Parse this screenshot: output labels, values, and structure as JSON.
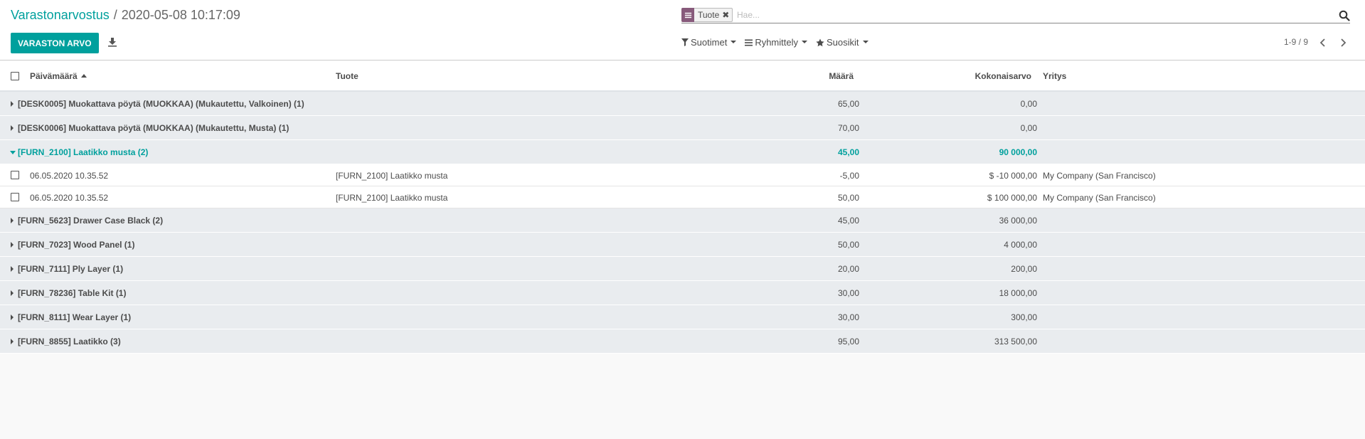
{
  "breadcrumb": {
    "parent": "Varastonarvostus",
    "separator": "/",
    "current": "2020-05-08 10:17:09"
  },
  "search": {
    "facet_label": "Tuote",
    "placeholder": "Hae..."
  },
  "toolbar": {
    "primary_button": "VARASTON ARVO"
  },
  "filters": {
    "filters_label": "Suotimet",
    "group_by_label": "Ryhmittely",
    "favorites_label": "Suosikit"
  },
  "pager": {
    "value": "1-9 / 9"
  },
  "columns": {
    "date": "Päivämäärä",
    "product": "Tuote",
    "quantity": "Määrä",
    "total_value": "Kokonaisarvo",
    "company": "Yritys"
  },
  "groups": [
    {
      "name": "[DESK0005] Muokattava pöytä (MUOKKAA) (Mukautettu, Valkoinen) (1)",
      "quantity": "65,00",
      "value": "0,00",
      "open": false,
      "records": []
    },
    {
      "name": "[DESK0006] Muokattava pöytä (MUOKKAA) (Mukautettu, Musta) (1)",
      "quantity": "70,00",
      "value": "0,00",
      "open": false,
      "records": []
    },
    {
      "name": "[FURN_2100] Laatikko musta (2)",
      "quantity": "45,00",
      "value": "90 000,00",
      "open": true,
      "records": [
        {
          "date": "06.05.2020 10.35.52",
          "product": "[FURN_2100] Laatikko musta",
          "quantity": "-5,00",
          "value": "$ -10 000,00",
          "company": "My Company (San Francisco)"
        },
        {
          "date": "06.05.2020 10.35.52",
          "product": "[FURN_2100] Laatikko musta",
          "quantity": "50,00",
          "value": "$ 100 000,00",
          "company": "My Company (San Francisco)"
        }
      ]
    },
    {
      "name": "[FURN_5623] Drawer Case Black (2)",
      "quantity": "45,00",
      "value": "36 000,00",
      "open": false,
      "records": []
    },
    {
      "name": "[FURN_7023] Wood Panel (1)",
      "quantity": "50,00",
      "value": "4 000,00",
      "open": false,
      "records": []
    },
    {
      "name": "[FURN_7111] Ply Layer (1)",
      "quantity": "20,00",
      "value": "200,00",
      "open": false,
      "records": []
    },
    {
      "name": "[FURN_78236] Table Kit (1)",
      "quantity": "30,00",
      "value": "18 000,00",
      "open": false,
      "records": []
    },
    {
      "name": "[FURN_8111] Wear Layer (1)",
      "quantity": "30,00",
      "value": "300,00",
      "open": false,
      "records": []
    },
    {
      "name": "[FURN_8855] Laatikko (3)",
      "quantity": "95,00",
      "value": "313 500,00",
      "open": false,
      "records": []
    }
  ],
  "colors": {
    "accent": "#00a09d",
    "facet": "#875a7b",
    "group_bg": "#e9ecef"
  }
}
